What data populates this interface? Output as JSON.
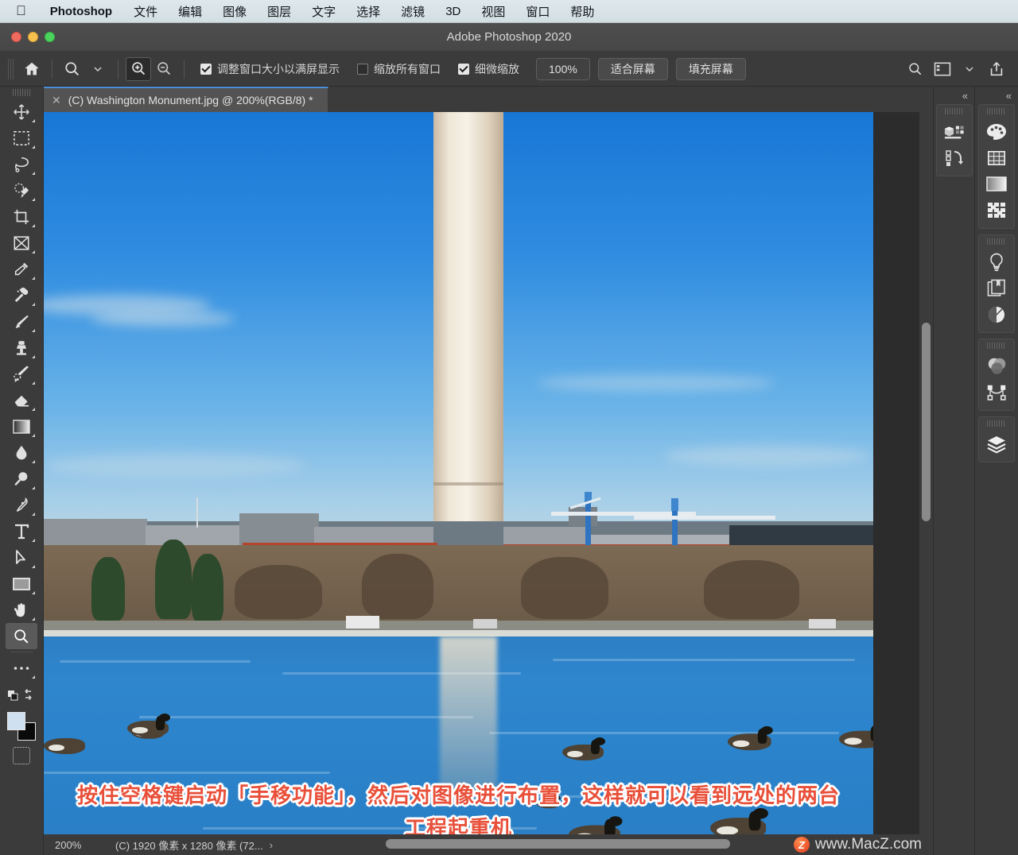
{
  "menubar": {
    "apple_icon": "apple-logo-icon",
    "app_name": "Photoshop",
    "items": [
      "文件",
      "编辑",
      "图像",
      "图层",
      "文字",
      "选择",
      "滤镜",
      "3D",
      "视图",
      "窗口",
      "帮助"
    ]
  },
  "window": {
    "title": "Adobe Photoshop 2020",
    "traffic_lights": [
      "close",
      "minimize",
      "zoom"
    ]
  },
  "options_bar": {
    "home_icon": "home-icon",
    "tool_preset_icon": "zoom-tool-icon",
    "tool_preset_chevron": "chevron-down-icon",
    "zoom_in_icon": "zoom-in-icon",
    "zoom_out_icon": "zoom-out-icon",
    "checkboxes": [
      {
        "label": "调整窗口大小以满屏显示",
        "checked": true
      },
      {
        "label": "缩放所有窗口",
        "checked": false
      },
      {
        "label": "细微缩放",
        "checked": true
      }
    ],
    "buttons": [
      "100%",
      "适合屏幕",
      "填充屏幕"
    ],
    "right_icons": [
      "search-icon",
      "workspace-icon",
      "chevron-down-icon",
      "share-icon"
    ]
  },
  "toolbox": {
    "tools": [
      {
        "name": "move-tool",
        "selected": false
      },
      {
        "name": "rectangular-marquee-tool",
        "selected": false
      },
      {
        "name": "lasso-tool",
        "selected": false
      },
      {
        "name": "quick-selection-tool",
        "selected": false
      },
      {
        "name": "crop-tool",
        "selected": false
      },
      {
        "name": "frame-tool",
        "selected": false
      },
      {
        "name": "eyedropper-tool",
        "selected": false
      },
      {
        "name": "spot-healing-brush-tool",
        "selected": false
      },
      {
        "name": "brush-tool",
        "selected": false
      },
      {
        "name": "clone-stamp-tool",
        "selected": false
      },
      {
        "name": "history-brush-tool",
        "selected": false
      },
      {
        "name": "eraser-tool",
        "selected": false
      },
      {
        "name": "gradient-tool",
        "selected": false
      },
      {
        "name": "blur-tool",
        "selected": false
      },
      {
        "name": "dodge-tool",
        "selected": false
      },
      {
        "name": "pen-tool",
        "selected": false
      },
      {
        "name": "horizontal-type-tool",
        "selected": false
      },
      {
        "name": "path-selection-tool",
        "selected": false
      },
      {
        "name": "rectangle-tool",
        "selected": false
      },
      {
        "name": "hand-tool",
        "selected": false
      },
      {
        "name": "zoom-tool",
        "selected": true
      },
      {
        "name": "edit-toolbar-tool",
        "selected": false
      }
    ],
    "foreground_color": "#cfe0f0",
    "background_color": "#0a0a0a",
    "quick_mask_icon": "quick-mask-icon"
  },
  "document": {
    "close_icon": "close-icon",
    "tab_title": "(C) Washington Monument.jpg @ 200%(RGB/8) *"
  },
  "annotation": {
    "line1": "按住空格键启动「手移功能」，然后对图像进行布置，这样就可以看到远处的两台",
    "line2": "工程起重机",
    "color": "#e8503a",
    "outline_color": "#ffffff"
  },
  "status_bar": {
    "zoom": "200%",
    "document_size": "(C) 1920 像素 x 1280 像素 (72...",
    "arrow_icon": "chevron-right-icon",
    "watermark_logo": "macz-logo-icon",
    "watermark_text": "www.MacZ.com"
  },
  "panels": {
    "collapse_icon": "double-chevron-left-icon",
    "inner_rail": {
      "groups": [
        {
          "icons": [
            "3d-panel-icon",
            "history-panel-icon"
          ]
        }
      ]
    },
    "outer_rail": {
      "groups": [
        {
          "icons": [
            "color-swatches-icon",
            "swatches-grid-icon",
            "gradients-icon",
            "patterns-icon"
          ]
        },
        {
          "icons": [
            "adjustments-icon",
            "libraries-icon",
            "properties-icon"
          ]
        },
        {
          "icons": [
            "channels-icon",
            "paths-icon"
          ]
        },
        {
          "icons": [
            "layers-icon"
          ]
        }
      ]
    }
  },
  "canvas": {
    "image_subject": "Washington Monument over Tidal Basin with geese",
    "vertical_scrollbar": "vertical-scrollbar",
    "horizontal_scrollbar": "horizontal-scrollbar"
  }
}
